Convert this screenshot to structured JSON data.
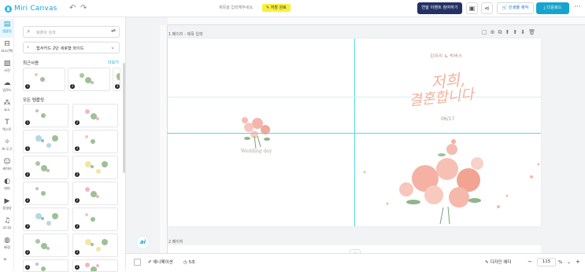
{
  "app": {
    "logo_text": "Miri Canvas",
    "brand_color": "#16a4cf"
  },
  "topbar": {
    "title_placeholder": "제목을 입력해주세요.",
    "save_badge": "저장 완료",
    "event_button": "연말 이벤트 참여하기",
    "print_button": "인쇄물 제작",
    "download_button": "다운로드",
    "more": "···"
  },
  "rail": [
    {
      "label": "템플릿",
      "icon": "template-icon",
      "glyph": "▤",
      "active": true
    },
    {
      "label": "요소(랙)",
      "icon": "element-icon",
      "glyph": "⊟",
      "active": false
    },
    {
      "label": "사진",
      "icon": "photo-icon",
      "glyph": "▨",
      "active": false
    },
    {
      "label": "업로드",
      "icon": "upload-icon",
      "glyph": "☁",
      "active": false
    },
    {
      "label": "요소",
      "icon": "shapes-icon",
      "glyph": "⁂",
      "active": false
    },
    {
      "label": "텍스트",
      "icon": "text-icon",
      "glyph": "T",
      "active": false
    },
    {
      "label": "AI 도구",
      "icon": "ai-tools-icon",
      "glyph": "✧",
      "active": false
    },
    {
      "label": "캐릭터",
      "icon": "character-icon",
      "glyph": "☺",
      "active": false
    },
    {
      "label": "테마",
      "icon": "theme-icon",
      "glyph": "◐",
      "active": false
    },
    {
      "label": "동영상",
      "icon": "video-icon",
      "glyph": "▶",
      "active": false
    },
    {
      "label": "오디오",
      "icon": "audio-icon",
      "glyph": "♫",
      "active": false
    },
    {
      "label": "배경",
      "icon": "background-icon",
      "glyph": "◍",
      "active": false
    }
  ],
  "rail_collapse": "«",
  "panel": {
    "search_placeholder": "템플릿 검색",
    "category": "접서카드 2단 세로형 와이드",
    "recent_title": "최근사용",
    "recent_more": "더보기",
    "all_title": "모든 템플릿",
    "recent_badges": [
      "1",
      "2",
      "3"
    ],
    "grid_badges": [
      "1",
      "2",
      "1",
      "2",
      "2",
      "2",
      "2",
      "2",
      "2",
      "2",
      "2",
      "2",
      "2",
      "2",
      "2",
      "2",
      "2",
      "2",
      "2",
      "2"
    ]
  },
  "canvas": {
    "page1_label": "1 페이지 - 제목 입력",
    "page2_label": "2 페이지",
    "names": "김미리 & 박버스",
    "script_line1": "저희,",
    "script_line2": "결혼합니다",
    "date": "06/17",
    "wedding_day": "Wedding day",
    "ai_badge": "ai"
  },
  "page_tools": [
    "□",
    "⊕",
    "⧉",
    "⬆",
    "⬆",
    "⬇",
    "🗑"
  ],
  "bottombar": {
    "animation": "애니메이션",
    "duration": "5초",
    "design_checker": "디자인 헤더",
    "zoom": "115",
    "zoom_unit": "%"
  }
}
